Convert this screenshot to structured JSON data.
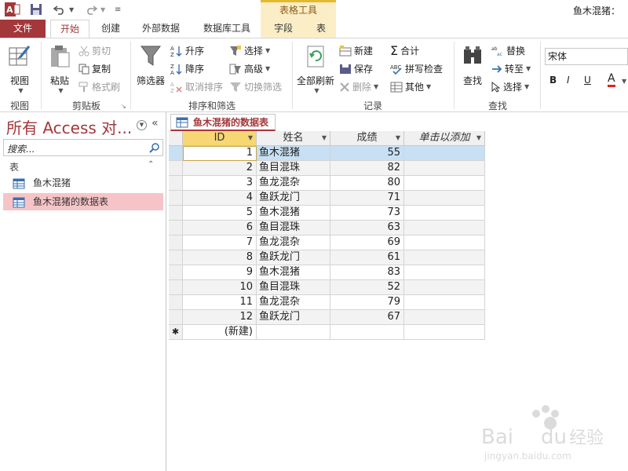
{
  "titlebar": {
    "app_icon": "access-app-icon",
    "context_group": "表格工具",
    "user": "鱼木混猪："
  },
  "tabs": [
    "文件",
    "开始",
    "创建",
    "外部数据",
    "数据库工具",
    "字段",
    "表"
  ],
  "ribbon": {
    "groups": {
      "view": "视图",
      "clipboard": "剪贴板",
      "sort_filter": "排序和筛选",
      "records": "记录",
      "find": "查找"
    },
    "view_btn": "视图",
    "paste_btn": "粘贴",
    "cut": "剪切",
    "copy": "复制",
    "format_painter": "格式刷",
    "filter_btn": "筛选器",
    "ascending": "升序",
    "descending": "降序",
    "remove_sort": "取消排序",
    "selection": "选择",
    "advanced": "高级",
    "toggle_filter": "切换筛选",
    "refresh_all": "全部刷新",
    "new": "新建",
    "save": "保存",
    "delete": "删除",
    "totals": "合计",
    "spelling": "拼写检查",
    "more": "其他",
    "find_btn": "查找",
    "replace": "替换",
    "goto": "转至",
    "select": "选择",
    "font_name": "宋体",
    "bold": "B",
    "italic": "I",
    "underline": "U",
    "font_color": "A",
    "accent": "#a4373a"
  },
  "nav": {
    "title": "所有 Access 对...",
    "search_placeholder": "搜索...",
    "section": "表",
    "items": [
      "鱼木混猪",
      "鱼木混猪的数据表"
    ]
  },
  "doc": {
    "tab_title": "鱼木混猪的数据表",
    "columns": [
      "ID",
      "姓名",
      "成绩",
      "单击以添加"
    ],
    "rows": [
      [
        "1",
        "鱼木混猪",
        "55"
      ],
      [
        "2",
        "鱼目混珠",
        "82"
      ],
      [
        "3",
        "鱼龙混杂",
        "80"
      ],
      [
        "4",
        "鱼跃龙门",
        "71"
      ],
      [
        "5",
        "鱼木混猪",
        "73"
      ],
      [
        "6",
        "鱼目混珠",
        "63"
      ],
      [
        "7",
        "鱼龙混杂",
        "69"
      ],
      [
        "8",
        "鱼跃龙门",
        "61"
      ],
      [
        "9",
        "鱼木混猪",
        "83"
      ],
      [
        "10",
        "鱼目混珠",
        "52"
      ],
      [
        "11",
        "鱼龙混杂",
        "79"
      ],
      [
        "12",
        "鱼跃龙门",
        "67"
      ]
    ],
    "new_row_marker": "✱",
    "new_row_label": "(新建)"
  },
  "watermark": {
    "logo": "Bai du 经验",
    "url": "jingyan.baidu.com"
  }
}
